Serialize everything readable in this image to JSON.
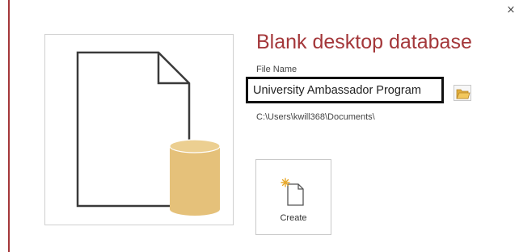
{
  "dialog": {
    "title": "Blank desktop database",
    "close_icon": "close-icon",
    "accent_color": "#a4373a"
  },
  "preview": {
    "icon": "blank-database-icon",
    "document_color": "#3a3a3a",
    "cylinder_color": "#e5c17a"
  },
  "file": {
    "label": "File Name",
    "value": "University Ambassador Program",
    "path": "C:\\Users\\kwill368\\Documents\\",
    "browse_icon": "folder-icon"
  },
  "create": {
    "label": "Create",
    "icon": "new-file-icon"
  }
}
